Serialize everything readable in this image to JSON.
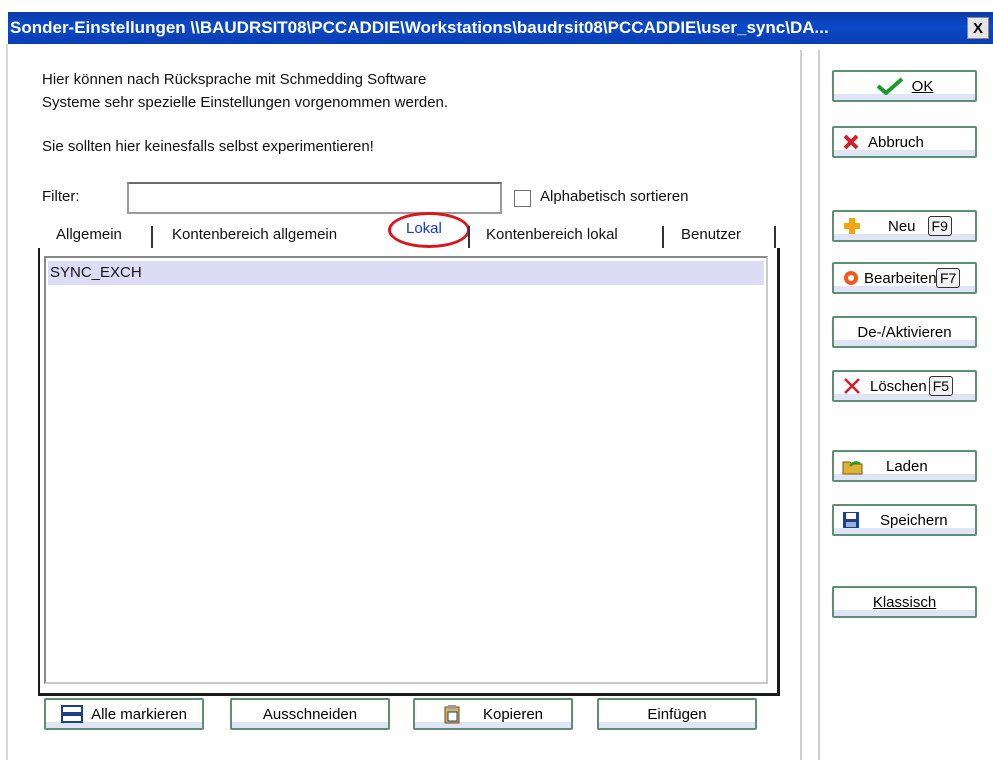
{
  "window": {
    "title": "Sonder-Einstellungen \\\\BAUDRSIT08\\PCCADDIE\\Workstations\\baudrsit08\\PCCADDIE\\user_sync\\DA...",
    "close_label": "X"
  },
  "intro": {
    "line1": "Hier können nach Rücksprache mit Schmedding Software",
    "line2": "Systeme sehr spezielle Einstellungen vorgenommen werden.",
    "warning": "Sie sollten hier keinesfalls selbst experimentieren!"
  },
  "filter": {
    "label": "Filter:",
    "value": "",
    "sort_label": "Alphabetisch sortieren",
    "sort_checked": false
  },
  "tabs": [
    {
      "label": "Allgemein",
      "active": false
    },
    {
      "label": "Kontenbereich allgemein",
      "active": false
    },
    {
      "label": "Lokal",
      "active": true
    },
    {
      "label": "Kontenbereich lokal",
      "active": false
    },
    {
      "label": "Benutzer",
      "active": false
    }
  ],
  "list": {
    "items": [
      "SYNC_EXCH"
    ]
  },
  "side_buttons": {
    "ok": "OK",
    "abbruch": "Abbruch",
    "neu": "Neu",
    "neu_key": "F9",
    "bearbeiten": "Bearbeiten",
    "bearbeiten_key": "F7",
    "deaktivieren": "De-/Aktivieren",
    "loeschen": "Löschen",
    "loeschen_key": "F5",
    "laden": "Laden",
    "speichern": "Speichern",
    "klassisch": "Klassisch"
  },
  "bottom_buttons": {
    "alle_markieren": "Alle markieren",
    "ausschneiden": "Ausschneiden",
    "kopieren": "Kopieren",
    "einfuegen": "Einfügen"
  },
  "colors": {
    "titlebar": "#0b49c8",
    "active_tab": "#1638c8",
    "highlight": "#d9161c",
    "selected_row": "#dcdcf4"
  }
}
